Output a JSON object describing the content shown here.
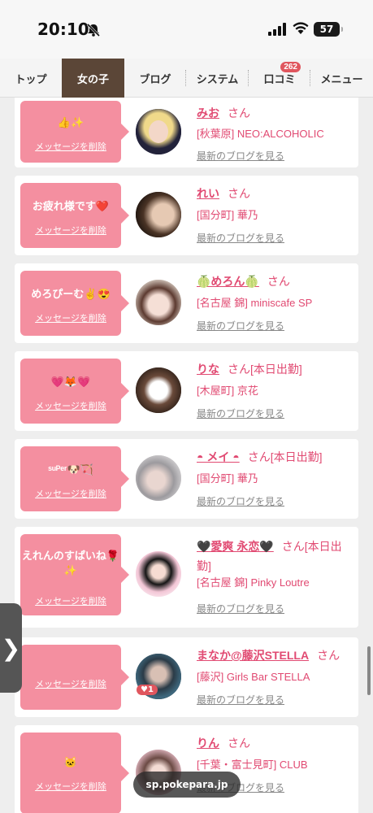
{
  "status": {
    "time": "20:10",
    "battery": "57"
  },
  "nav": {
    "tabs": [
      {
        "label": "トップ"
      },
      {
        "label": "女の子"
      },
      {
        "label": "ブログ"
      },
      {
        "label": "システム"
      },
      {
        "label": "口コミ",
        "badge": "262"
      },
      {
        "label": "メニュー"
      }
    ],
    "active_index": 1
  },
  "colors": {
    "accent": "#e14a72",
    "bubble": "#f48fa0",
    "active_tab": "#5b4637"
  },
  "delete_label": "メッセージを削除",
  "blog_label": "最新のブログを見る",
  "girls": [
    {
      "message": "👍✨",
      "name": "みお",
      "suffix": "さん",
      "shop": "[秋葉原] NEO:ALCOHOLIC"
    },
    {
      "message": "お疲れ様です❤️",
      "name": "れい",
      "suffix": "さん",
      "shop": "[国分町] 華乃"
    },
    {
      "message": "めろぴーむ✌️😍",
      "name": "🍈めろん🍈",
      "suffix": "さん",
      "shop": "[名古屋 錦] miniscafe SP"
    },
    {
      "message": "💗🦊💗",
      "name": "りな",
      "suffix": "さん[本日出勤]",
      "shop": "[木屋町] 京花"
    },
    {
      "message": "ˢᵘᴾᵉʳ🐶🏹",
      "name": "◓ メイ ◓",
      "suffix": "さん[本日出勤]",
      "shop": "[国分町] 華乃"
    },
    {
      "message": "えれんのすぱいね🌹✨",
      "name": "🖤愛爽 永恋🖤",
      "suffix": "さん[本日出勤]",
      "shop": "[名古屋 錦] Pinky Loutre"
    },
    {
      "message": "",
      "name": "まなか@藤沢STELLA",
      "suffix": "さん",
      "shop": "[藤沢] Girls Bar STELLA",
      "likes": "1"
    },
    {
      "message": "🐱",
      "name": "りん",
      "suffix": "さん",
      "shop": "[千葉・富士見町] CLUB"
    }
  ],
  "url": "sp.pokepara.jp",
  "side_handle": "❯"
}
